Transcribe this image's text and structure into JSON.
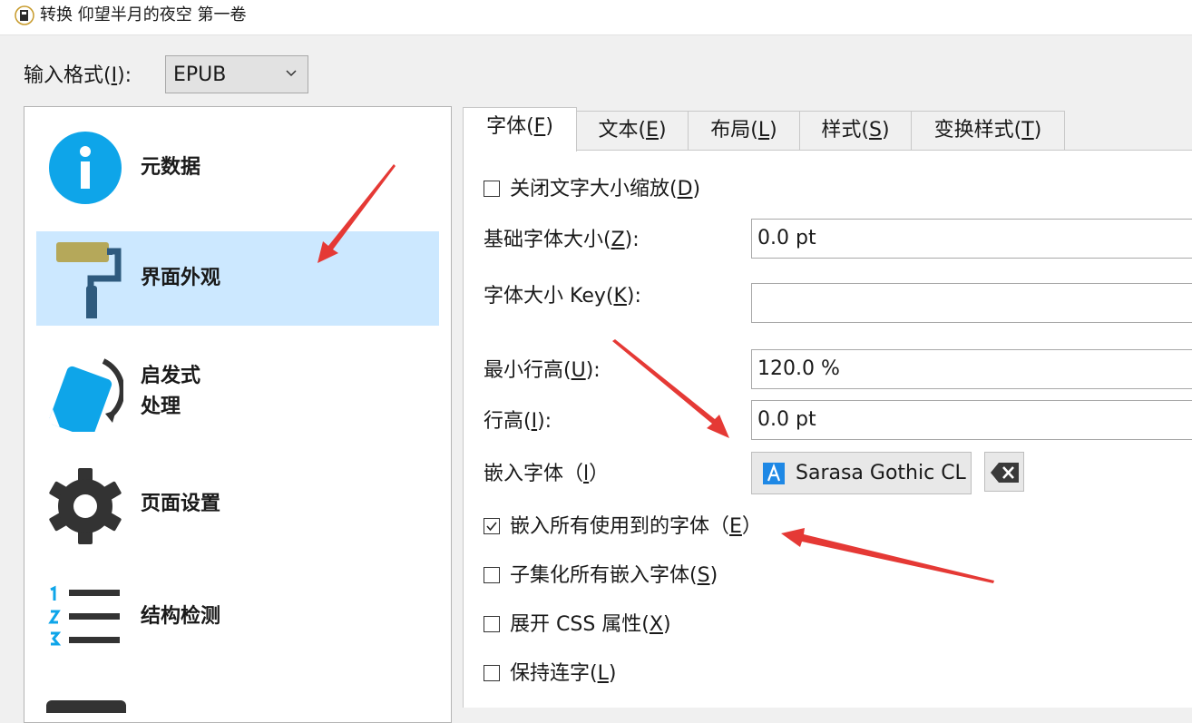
{
  "window": {
    "title": "转换 仰望半月的夜空 第一卷"
  },
  "input_format": {
    "label": "输入格式(",
    "label_key": "I",
    "label_end": "):",
    "value": "EPUB"
  },
  "sidebar": {
    "items": [
      {
        "label": "元数据",
        "icon": "info-icon"
      },
      {
        "label": "界面外观",
        "icon": "paint-roller-icon",
        "selected": true
      },
      {
        "label": "启发式",
        "label2": "处理",
        "icon": "heuristics-icon"
      },
      {
        "label": "页面设置",
        "icon": "gear-icon"
      },
      {
        "label": "结构检测",
        "icon": "numbered-list-icon"
      }
    ]
  },
  "tabs": [
    {
      "label": "字体(",
      "key": "F",
      "end": ")",
      "active": true
    },
    {
      "label": "文本(",
      "key": "E",
      "end": ")"
    },
    {
      "label": "布局(",
      "key": "L",
      "end": ")"
    },
    {
      "label": "样式(",
      "key": "S",
      "end": ")"
    },
    {
      "label": "变换样式(",
      "key": "T",
      "end": ")"
    }
  ],
  "font_panel": {
    "disable_font_rescaling": {
      "label": "关闭文字大小缩放(",
      "key": "D",
      "end": ")",
      "checked": false
    },
    "base_font_size": {
      "label": "基础字体大小(",
      "key": "Z",
      "end": "):",
      "value": "0.0 pt"
    },
    "font_size_key": {
      "label": "字体大小 Key(",
      "key": "K",
      "end": "):",
      "value": ""
    },
    "min_line_height": {
      "label": "最小行高(",
      "key": "U",
      "end": "):",
      "value": "120.0 %"
    },
    "line_height": {
      "label": "行高(",
      "key": "I",
      "end": "):",
      "value": "0.0 pt"
    },
    "embed_font": {
      "label": "嵌入字体（",
      "key": "l",
      "end": "）",
      "value": "Sarasa Gothic CL"
    },
    "embed_all_fonts": {
      "label": "嵌入所有使用到的字体（",
      "key": "E",
      "end": "）",
      "checked": true
    },
    "subset_fonts": {
      "label": "子集化所有嵌入字体(",
      "key": "S",
      "end": ")",
      "checked": false
    },
    "expand_css": {
      "label": "展开 CSS 属性(",
      "key": "X",
      "end": ")",
      "checked": false
    },
    "keep_ligatures": {
      "label": "保持连字(",
      "key": "L",
      "end": ")",
      "checked": false
    }
  },
  "colors": {
    "selection": "#cce8ff",
    "accent_blue": "#0ea5e9",
    "annotation_red": "#e53935",
    "icon_dark": "#333333"
  }
}
